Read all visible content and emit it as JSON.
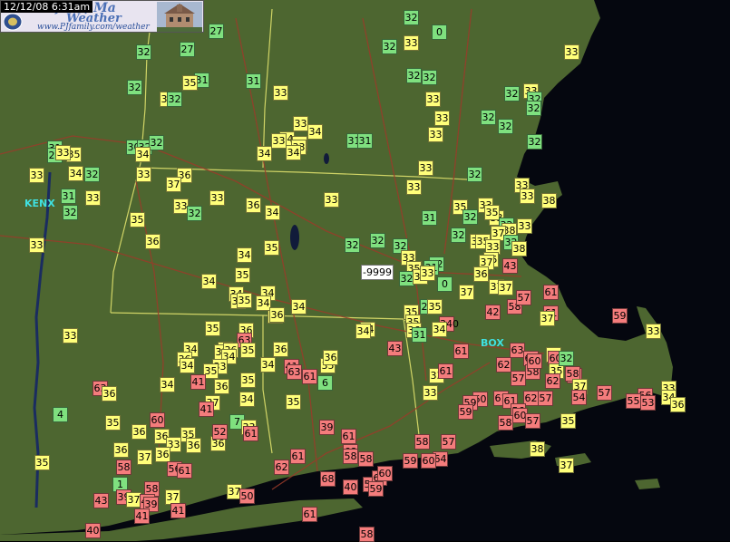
{
  "header": {
    "timestamp": "12/12/08 6:31am",
    "site_name": "ford, Ma",
    "site_sub": "Weather",
    "site_url": "www.PJfamily.com/weather"
  },
  "legend_colors": {
    "cold": "#7fe07f",
    "mild": "#ffff7a",
    "warm": "#f47c7c",
    "missing": "#ffffff",
    "land": "#4d6630",
    "ocean": "#040610",
    "border": "#e8e870",
    "road": "#9a3b2a"
  },
  "radar_sites": [
    {
      "name": "KENX",
      "color": "#40e0e0"
    },
    {
      "name": "BOX",
      "color": "#40e0e0"
    }
  ],
  "readings": [
    "32",
    "27",
    "0",
    "32",
    "33",
    "33",
    "27",
    "32",
    "32",
    "34",
    "32",
    "32",
    "31",
    "35",
    "31",
    "32",
    "33",
    "33",
    "32",
    "33",
    "32",
    "32",
    "33",
    "32",
    "34",
    "33",
    "34",
    "33",
    "35",
    "33",
    "32",
    "33",
    "31",
    "31",
    "32",
    "34",
    "35",
    "31",
    "28",
    "33",
    "30",
    "32",
    "32",
    "34",
    "33",
    "34",
    "33",
    "32",
    "34",
    "32",
    "33",
    "36",
    "37",
    "33",
    "31",
    "32",
    "33",
    "33",
    "33",
    "38",
    "36",
    "33",
    "33",
    "32",
    "35",
    "34",
    "31",
    "32",
    "33",
    "33",
    "33",
    "35",
    "32",
    "33",
    "38",
    "32",
    "37",
    "36",
    "35",
    "32",
    "32",
    "32",
    "37",
    "35",
    "33",
    "38",
    "34",
    "32",
    "-9999",
    "35",
    "35",
    "33",
    "35",
    "32",
    "31",
    "32",
    "33",
    "35",
    "33",
    "0",
    "34",
    "37",
    "36",
    "34",
    "37",
    "37",
    "37",
    "36",
    "33",
    "34",
    "35",
    "35",
    "34",
    "34",
    "35",
    "35",
    "27",
    "35",
    "340",
    "36",
    "34",
    "43",
    "42",
    "58",
    "61",
    "36",
    "35",
    "36",
    "34",
    "37",
    "31",
    "57",
    "59",
    "33",
    "33",
    "34",
    "63",
    "61",
    "37",
    "61",
    "33",
    "33",
    "36",
    "34",
    "35",
    "34",
    "36",
    "43",
    "33",
    "61",
    "62",
    "63",
    "62",
    "60",
    "35",
    "32",
    "33",
    "36",
    "34",
    "35",
    "34",
    "41",
    "63",
    "61",
    "56",
    "58",
    "58",
    "57",
    "60",
    "62",
    "63",
    "35",
    "41",
    "36",
    "34",
    "36",
    "33",
    "37",
    "62",
    "61",
    "60",
    "61",
    "59",
    "56",
    "57",
    "54",
    "57",
    "56",
    "33",
    "34",
    "36",
    "35",
    "37",
    "34",
    "35",
    "41",
    "60",
    "6",
    "59",
    "58",
    "63",
    "60",
    "57",
    "55",
    "53",
    "36",
    "35",
    "7",
    "36",
    "35",
    "36",
    "33",
    "4",
    "61",
    "39",
    "61",
    "68",
    "58",
    "58",
    "64",
    "35",
    "36",
    "37",
    "36",
    "33",
    "36",
    "36",
    "52",
    "62",
    "61",
    "59",
    "60",
    "59",
    "60",
    "57",
    "58",
    "38",
    "37",
    "35",
    "58",
    "56",
    "1",
    "61",
    "68",
    "40",
    "59",
    "60",
    "58",
    "37",
    "39",
    "37",
    "50",
    "41",
    "43",
    "37",
    "40",
    "39",
    "40",
    "41",
    "61",
    "58",
    "39"
  ]
}
